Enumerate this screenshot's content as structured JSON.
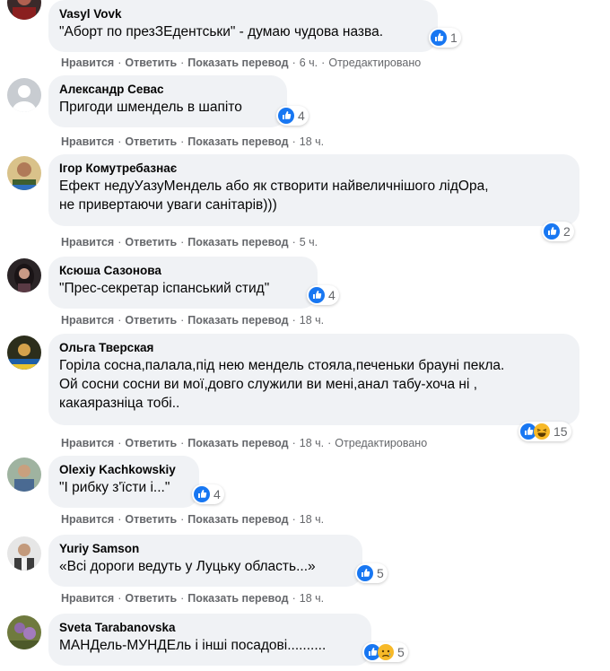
{
  "actions": {
    "like_label": "Нравится",
    "reply_label": "Ответить",
    "translate_label": "Показать перевод",
    "separator": "·"
  },
  "colors": {
    "bubble": "#f0f2f5",
    "like_blue": "#1877f2",
    "haha_yellow": "#f7b928",
    "meta_text": "#65676b"
  },
  "comments": [
    {
      "author": "Vasyl Vovk",
      "lines": [
        "\"Аборт по презЗЕдентськи\" - думаю чудова назва."
      ],
      "reaction_count": "1",
      "reaction_icons": [
        "like-icon"
      ],
      "time": "6 ч.",
      "edited": "Отредактировано",
      "avatar_icon": "avatar-photo"
    },
    {
      "author": "Александр Севас",
      "lines": [
        "Пригоди шмендель в шапіто"
      ],
      "reaction_count": "4",
      "reaction_icons": [
        "like-icon"
      ],
      "time": "18 ч.",
      "edited": "",
      "avatar_icon": "default-avatar"
    },
    {
      "author": "Ігор Комутребазнає",
      "lines": [
        "Ефект недуУазуМендель або як створити найвеличнішого лідОра,",
        "не привертаючи уваги санітарів)))"
      ],
      "reaction_count": "2",
      "reaction_icons": [
        "like-icon"
      ],
      "time": "5 ч.",
      "edited": "",
      "avatar_icon": "avatar-photo"
    },
    {
      "author": "Ксюша Сазонова",
      "lines": [
        "\"Прес-секретар іспанський стид\""
      ],
      "reaction_count": "4",
      "reaction_icons": [
        "like-icon"
      ],
      "time": "18 ч.",
      "edited": "",
      "avatar_icon": "avatar-photo"
    },
    {
      "author": "Ольга Тверская",
      "lines": [
        "Горіла сосна,палала,під нею мендель стояла,печеньки брауні пекла.",
        "Ой сосни сосни ви мої,довго служили ви мені,анал табу-хоча ні ,",
        "какаяразніца тобі.."
      ],
      "reaction_count": "15",
      "reaction_icons": [
        "like-icon",
        "haha-icon"
      ],
      "time": "18 ч.",
      "edited": "Отредактировано",
      "avatar_icon": "avatar-photo"
    },
    {
      "author": "Olexiy Kachkowskiy",
      "lines": [
        "\"І рибку з'їсти і...\""
      ],
      "reaction_count": "4",
      "reaction_icons": [
        "like-icon"
      ],
      "time": "18 ч.",
      "edited": "",
      "avatar_icon": "avatar-photo"
    },
    {
      "author": "Yuriy Samson",
      "lines": [
        "«Всі дороги ведуть у Луцьку область...»"
      ],
      "reaction_count": "5",
      "reaction_icons": [
        "like-icon"
      ],
      "time": "18 ч.",
      "edited": "",
      "avatar_icon": "avatar-photo"
    },
    {
      "author": "Sveta Tarabanovska",
      "lines": [
        "МАНДель-МУНДЕль і інші посадові.........."
      ],
      "reaction_count": "5",
      "reaction_icons": [
        "like-icon",
        "sad-icon"
      ],
      "time": "",
      "edited": "",
      "avatar_icon": "avatar-photo"
    }
  ]
}
